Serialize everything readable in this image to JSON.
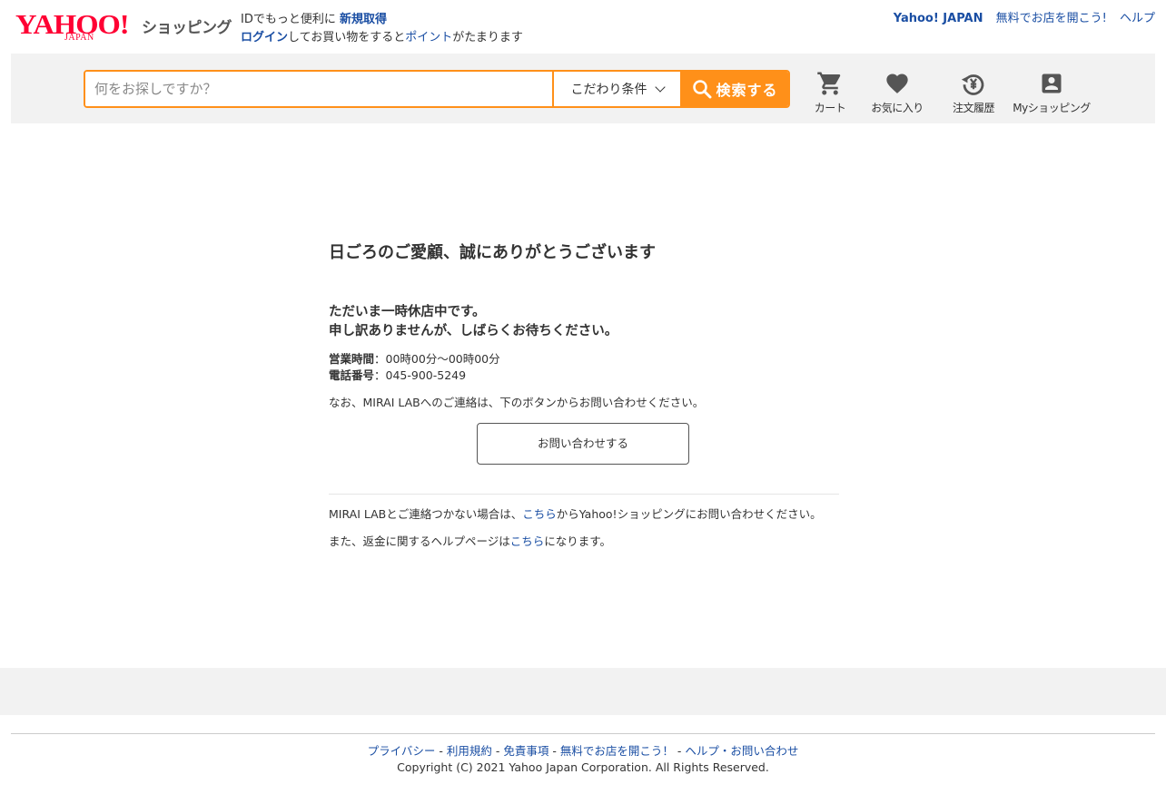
{
  "header": {
    "logo_text": "YAHOO!",
    "logo_sub": "JAPAN",
    "logo_service": "ショッピング",
    "login_line1_prefix": "IDでもっと便利に",
    "register_link": "新規取得",
    "login_link": "ログイン",
    "login_line2_mid": "してお買い物をすると",
    "points_link": "ポイント",
    "login_line2_suffix": "がたまります",
    "top_links": {
      "yahoo_japan": "Yahoo! JAPAN",
      "open_store": "無料でお店を開こう!",
      "help": "ヘルプ"
    }
  },
  "search": {
    "placeholder": "何をお探しですか？",
    "filter_label": "こだわり条件",
    "button_label": "検索する"
  },
  "nav": {
    "cart": "カート",
    "favorites": "お気に入り",
    "order_history": "注文履歴",
    "my_shopping": "Myショッピング"
  },
  "main": {
    "greeting": "日ごろのご愛顧、誠にありがとうございます",
    "closed_line1": "ただいま一時休店中です。",
    "closed_line2": "申し訳ありませんが、しばらくお待ちください。",
    "hours_label": "営業時間",
    "hours_value": "：00時00分～00時00分",
    "phone_label": "電話番号",
    "phone_value": "：045-900-5249",
    "contact_note": "なお、MIRAI LABへのご連絡は、下のボタンからお問い合わせください。",
    "contact_button": "お問い合わせする",
    "note1_prefix": "MIRAI LABとご連絡つかない場合は、",
    "note1_link": "こちら",
    "note1_suffix": "からYahoo!ショッピングにお問い合わせください。",
    "note2_prefix": "また、返金に関するヘルプページは",
    "note2_link": "こちら",
    "note2_suffix": "になります。"
  },
  "footer": {
    "privacy": "プライバシー",
    "terms": "利用規約",
    "disclaimer": "免責事項",
    "open_store": "無料でお店を開こう！",
    "help": "ヘルプ",
    "contact": "お問い合わせ",
    "sep": " - ",
    "dot": "・",
    "copyright": "Copyright (C) 2021 Yahoo Japan Corporation. All Rights Reserved."
  },
  "colors": {
    "accent": "#ff9019",
    "brand": "#ff0033",
    "link": "#1a4ea3",
    "icon": "#555555"
  },
  "icons": {
    "cart": "cart-icon",
    "favorites": "heart-icon",
    "history": "history-yen-icon",
    "my_shopping": "account-box-icon",
    "search": "search-icon",
    "chevron": "chevron-down-icon"
  }
}
